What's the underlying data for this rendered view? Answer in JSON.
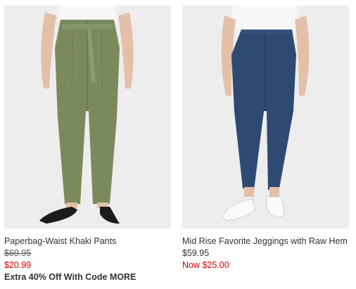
{
  "products": [
    {
      "name": "Paperbag-Waist Khaki Pants",
      "original_price": "$69.95",
      "sale_price": "$20.99",
      "promo": "Extra 40% Off With Code MORE",
      "sale_color": "#d00000",
      "image_icon": "khaki-pants-product-photo"
    },
    {
      "name": "Mid Rise Favorite Jeggings with Raw Hem",
      "original_price": "$59.95",
      "sale_price": "Now $25.00",
      "sale_color": "#d00000",
      "image_icon": "jeggings-product-photo"
    }
  ]
}
